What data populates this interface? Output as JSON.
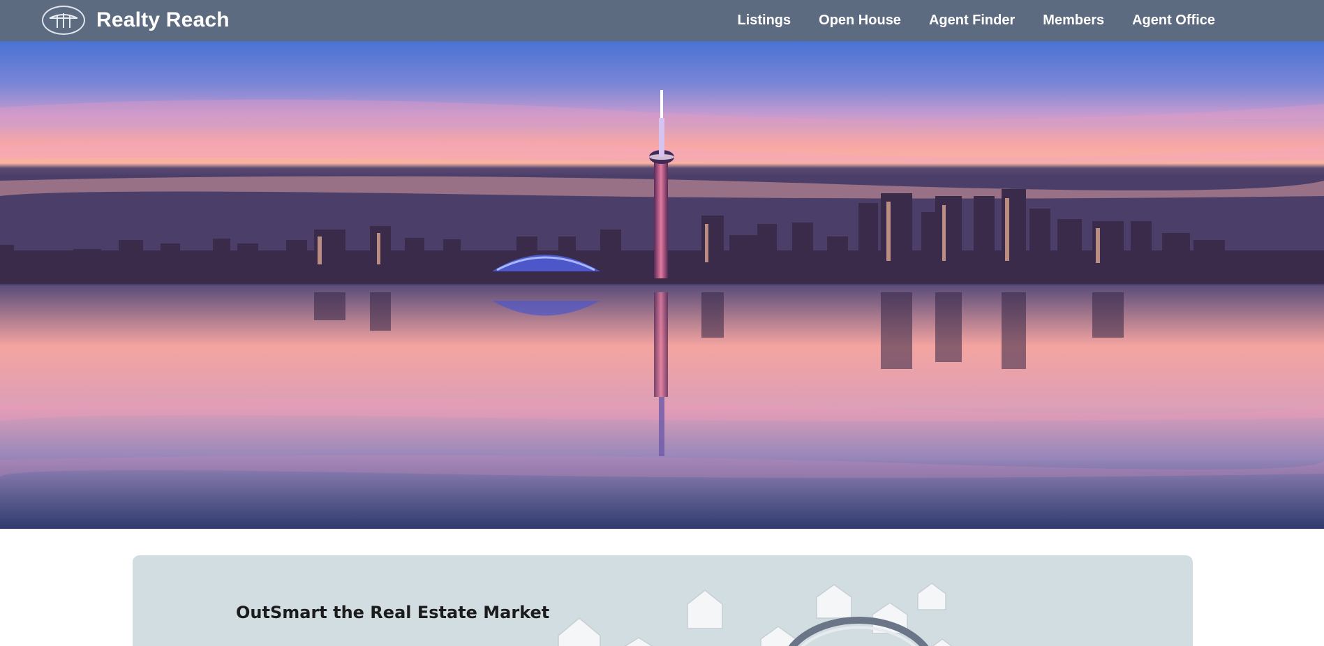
{
  "header": {
    "brand": "Realty Reach",
    "logo_icon": "bridge-logo-icon",
    "nav": [
      {
        "label": "Listings"
      },
      {
        "label": "Open House"
      },
      {
        "label": "Agent Finder"
      },
      {
        "label": "Members"
      },
      {
        "label": "Agent Office"
      }
    ],
    "background_color": "#5d6b80"
  },
  "hero": {
    "image": "city-skyline-at-sunset-reflected-in-water"
  },
  "promo_card": {
    "title": "OutSmart the Real Estate Market",
    "art": "houses-around-magnifying-glass",
    "background_color": "#d2dde2"
  }
}
